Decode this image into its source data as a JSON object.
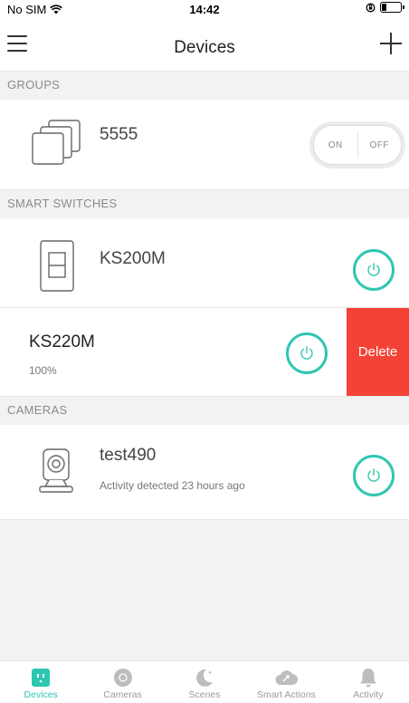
{
  "status": {
    "carrier": "No SIM",
    "time": "14:42"
  },
  "nav": {
    "title": "Devices"
  },
  "sections": {
    "groups": "GROUPS",
    "smart_switches": "SMART SWITCHES",
    "cameras": "CAMERAS"
  },
  "groups": [
    {
      "name": "5555",
      "on_label": "ON",
      "off_label": "OFF",
      "icon": "stacked-squares-icon"
    }
  ],
  "switches": [
    {
      "name": "KS200M",
      "icon": "light-switch-icon"
    },
    {
      "name": "KS220M",
      "sub": "100%",
      "delete_label": "Delete"
    }
  ],
  "cameras": [
    {
      "name": "test490",
      "sub": "Activity detected 23 hours ago",
      "icon": "camera-icon"
    }
  ],
  "tabs": [
    {
      "label": "Devices",
      "icon": "plug-icon",
      "active": true
    },
    {
      "label": "Cameras",
      "icon": "camera-lens-icon"
    },
    {
      "label": "Scenes",
      "icon": "moon-icon"
    },
    {
      "label": "Smart Actions",
      "icon": "cloud-icon"
    },
    {
      "label": "Activity",
      "icon": "bell-icon"
    }
  ],
  "colors": {
    "accent": "#2fc6b2",
    "delete": "#f44236",
    "section_bg": "#f2f2f2"
  }
}
